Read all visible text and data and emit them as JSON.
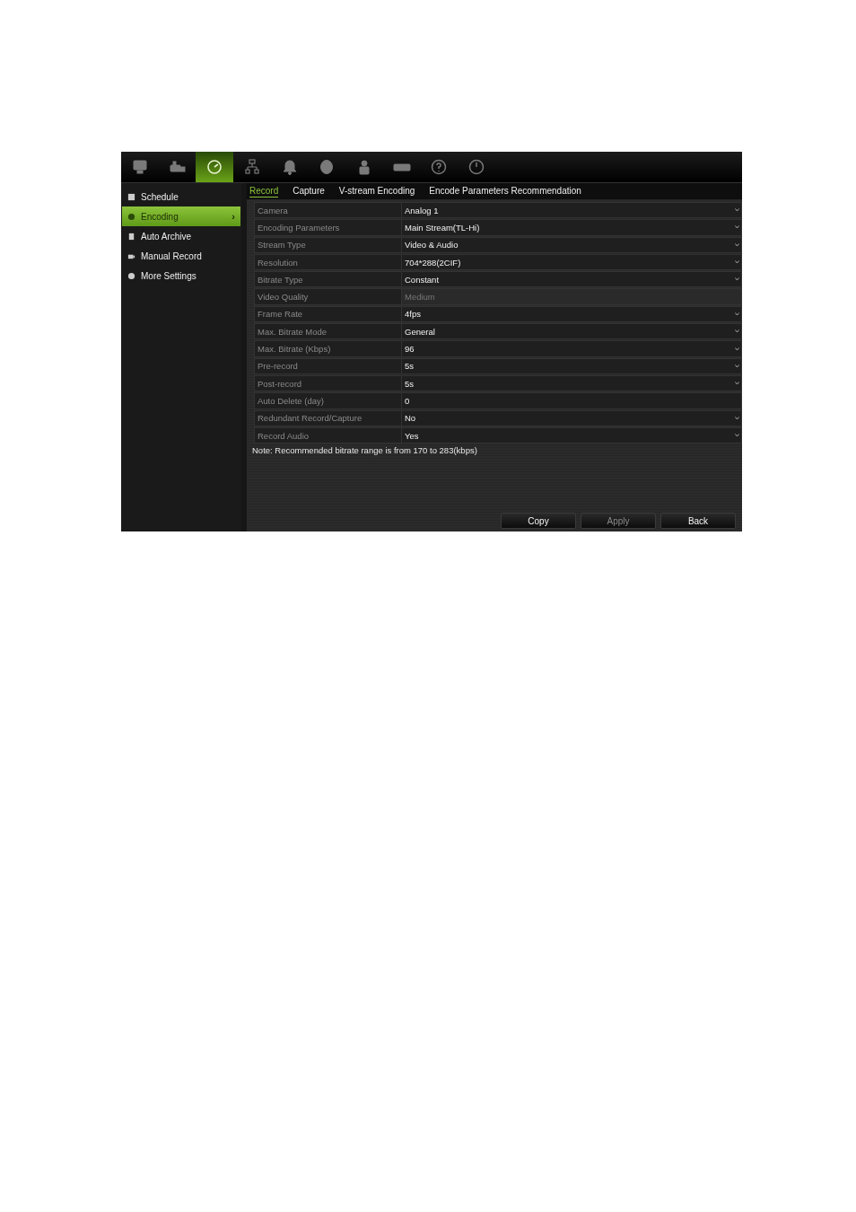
{
  "toolbar": [
    {
      "selected": false
    },
    {
      "selected": false
    },
    {
      "selected": true
    },
    {
      "selected": false
    },
    {
      "selected": false
    },
    {
      "selected": false
    },
    {
      "selected": false
    },
    {
      "selected": false
    },
    {
      "selected": false
    },
    {
      "selected": false
    }
  ],
  "sidebar": {
    "items": [
      {
        "label": "Schedule",
        "selected": false
      },
      {
        "label": "Encoding",
        "selected": true,
        "arrow": "›"
      },
      {
        "label": "Auto Archive",
        "selected": false
      },
      {
        "label": "Manual Record",
        "selected": false
      },
      {
        "label": "More Settings",
        "selected": false
      }
    ]
  },
  "tabs": [
    {
      "label": "Record",
      "selected": true
    },
    {
      "label": "Capture",
      "selected": false
    },
    {
      "label": "V-stream Encoding",
      "selected": false
    },
    {
      "label": "Encode Parameters Recommendation",
      "selected": false
    }
  ],
  "settings": [
    {
      "label": "Camera",
      "value": "Analog 1",
      "kind": "dropdown",
      "disabled": false
    },
    {
      "label": "Encoding Parameters",
      "value": "Main Stream(TL-Hi)",
      "kind": "dropdown",
      "disabled": false
    },
    {
      "label": "Stream Type",
      "value": "Video & Audio",
      "kind": "dropdown",
      "disabled": false
    },
    {
      "label": "Resolution",
      "value": "704*288(2CIF)",
      "kind": "dropdown",
      "disabled": false
    },
    {
      "label": "Bitrate Type",
      "value": "Constant",
      "kind": "dropdown",
      "disabled": false
    },
    {
      "label": "Video Quality",
      "value": "Medium",
      "kind": "dropdown",
      "disabled": true
    },
    {
      "label": "Frame Rate",
      "value": "4fps",
      "kind": "dropdown",
      "disabled": false
    },
    {
      "label": "Max. Bitrate Mode",
      "value": "General",
      "kind": "dropdown",
      "disabled": false
    },
    {
      "label": "Max. Bitrate (Kbps)",
      "value": "96",
      "kind": "dropdown",
      "disabled": false
    },
    {
      "label": "Pre-record",
      "value": "5s",
      "kind": "dropdown",
      "disabled": false
    },
    {
      "label": "Post-record",
      "value": "5s",
      "kind": "dropdown",
      "disabled": false
    },
    {
      "label": "Auto Delete (day)",
      "value": "0",
      "kind": "text",
      "disabled": false
    },
    {
      "label": "Redundant Record/Capture",
      "value": "No",
      "kind": "dropdown",
      "disabled": false
    },
    {
      "label": "Record Audio",
      "value": "Yes",
      "kind": "dropdown",
      "disabled": false
    }
  ],
  "note": "Note: Recommended bitrate range is from 170 to 283(kbps)",
  "buttons": [
    {
      "label": "Copy",
      "disabled": false
    },
    {
      "label": "Apply",
      "disabled": true
    },
    {
      "label": "Back",
      "disabled": false
    }
  ]
}
